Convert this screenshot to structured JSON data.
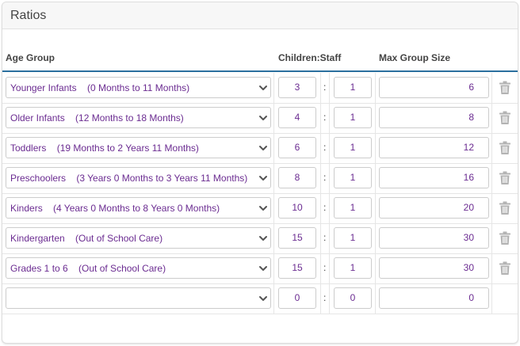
{
  "panel": {
    "title": "Ratios"
  },
  "table": {
    "headers": {
      "age_group": "Age Group",
      "children_staff": "Children:Staff",
      "max_group_size": "Max Group Size"
    },
    "separator": ":",
    "rows": [
      {
        "age_group": "Younger Infants    (0 Months to 11 Months)",
        "children": "3",
        "staff": "1",
        "max_group_size": "6",
        "deletable": true
      },
      {
        "age_group": "Older Infants    (12 Months to 18 Months)",
        "children": "4",
        "staff": "1",
        "max_group_size": "8",
        "deletable": true
      },
      {
        "age_group": "Toddlers    (19 Months to 2 Years 11 Months)",
        "children": "6",
        "staff": "1",
        "max_group_size": "12",
        "deletable": true
      },
      {
        "age_group": "Preschoolers    (3 Years 0 Months to 3 Years 11 Months)",
        "children": "8",
        "staff": "1",
        "max_group_size": "16",
        "deletable": true
      },
      {
        "age_group": "Kinders    (4 Years 0 Months to 8 Years 0 Months)",
        "children": "10",
        "staff": "1",
        "max_group_size": "20",
        "deletable": true
      },
      {
        "age_group": "Kindergarten    (Out of School Care)",
        "children": "15",
        "staff": "1",
        "max_group_size": "30",
        "deletable": true
      },
      {
        "age_group": "Grades 1 to 6    (Out of School Care)",
        "children": "15",
        "staff": "1",
        "max_group_size": "30",
        "deletable": true
      },
      {
        "age_group": "",
        "children": "0",
        "staff": "0",
        "max_group_size": "0",
        "deletable": false
      }
    ]
  },
  "icons": {
    "dropdown": "chevron-down-icon",
    "delete": "trash-icon"
  },
  "colors": {
    "value_text": "#6b2c91",
    "header_rule": "#2b6f9e",
    "trash": "#b3b3b3",
    "chevron": "#555555"
  }
}
